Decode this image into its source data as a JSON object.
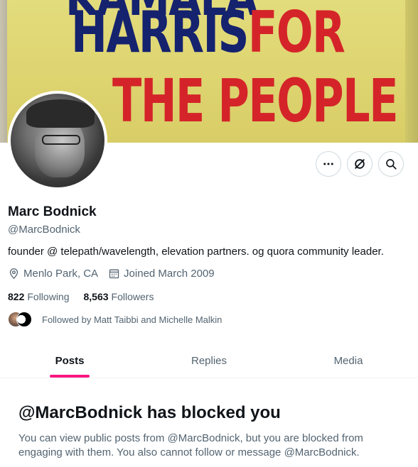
{
  "banner": {
    "line1": "KAMALA",
    "line2_a": "HARRIS",
    "line2_b": "FOR",
    "line3": "THE PEOPLE"
  },
  "profile": {
    "name": "Marc Bodnick",
    "handle": "@MarcBodnick",
    "bio": "founder @ telepath/wavelength, elevation partners. og quora community leader.",
    "location": "Menlo Park, CA",
    "joined": "Joined March 2009",
    "following_count": "822",
    "following_label": "Following",
    "followers_count": "8,563",
    "followers_label": "Followers",
    "followed_by": "Followed by Matt Taibbi and Michelle Malkin"
  },
  "actions": {
    "more_icon": "more-horizontal-icon",
    "grok_icon": "grok-icon",
    "search_icon": "search-icon"
  },
  "tabs": [
    {
      "label": "Posts",
      "active": true
    },
    {
      "label": "Replies",
      "active": false
    },
    {
      "label": "Media",
      "active": false
    }
  ],
  "blocked": {
    "title": "@MarcBodnick has blocked you",
    "description": "You can view public posts from @MarcBodnick, but you are blocked from engaging with them. You also cannot follow or message @MarcBodnick."
  },
  "colors": {
    "accent": "#f91880",
    "text_primary": "#0f1419",
    "text_secondary": "#536471",
    "banner_blue": "#15226e",
    "banner_red": "#d42429",
    "banner_yellow": "#ddd36f"
  }
}
